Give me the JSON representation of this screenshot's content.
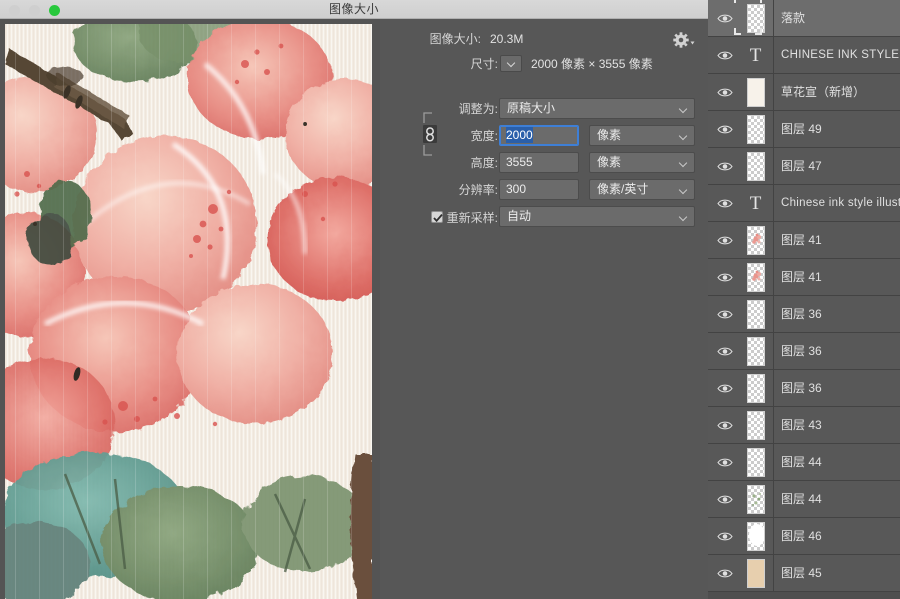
{
  "window": {
    "title": "图像大小",
    "controls": [
      {
        "name": "close",
        "color": "#cfcfcf"
      },
      {
        "name": "minimize",
        "color": "#cfcfcf"
      },
      {
        "name": "zoom",
        "color": "#28c83c"
      }
    ]
  },
  "dialog": {
    "image_size": {
      "label": "图像大小:",
      "value": "20.3M"
    },
    "gear_icon": "gear-icon",
    "dimensions": {
      "label": "尺寸:",
      "value": "2000 像素 × 3555 像素"
    },
    "fit_to": {
      "label": "调整为:",
      "value": "原稿大小"
    },
    "width": {
      "label": "宽度:",
      "value": "2000",
      "unit": "像素",
      "focused": true,
      "selected": true
    },
    "height": {
      "label": "高度:",
      "value": "3555",
      "unit": "像素"
    },
    "resolution": {
      "label": "分辨率:",
      "value": "300",
      "unit": "像素/英寸"
    },
    "resample": {
      "label": "重新采样:",
      "value": "自动",
      "checked": true
    },
    "link_icon": "chain-link-icon"
  },
  "layers_panel": {
    "rows": [
      {
        "name": "落款",
        "kind": "raster",
        "selected": true,
        "thumb": "transparent"
      },
      {
        "name": "CHINESE INK STYLE",
        "kind": "text",
        "selected": false,
        "latin": true
      },
      {
        "name": "草花宣（新增）",
        "kind": "raster",
        "selected": false,
        "thumb": "paper"
      },
      {
        "name": "图层 49",
        "kind": "raster",
        "selected": false,
        "thumb": "transparent"
      },
      {
        "name": "图层 47",
        "kind": "raster",
        "selected": false,
        "thumb": "transparent"
      },
      {
        "name": "Chinese ink style illustration",
        "kind": "text",
        "selected": false,
        "latin": true
      },
      {
        "name": "图层 41",
        "kind": "raster",
        "selected": false,
        "thumb": "pink-blossom"
      },
      {
        "name": "图层 41",
        "kind": "raster",
        "selected": false,
        "thumb": "pink-blossom"
      },
      {
        "name": "图层 36",
        "kind": "raster",
        "selected": false,
        "thumb": "transparent"
      },
      {
        "name": "图层 36",
        "kind": "raster",
        "selected": false,
        "thumb": "transparent"
      },
      {
        "name": "图层 36",
        "kind": "raster",
        "selected": false,
        "thumb": "transparent"
      },
      {
        "name": "图层 43",
        "kind": "raster",
        "selected": false,
        "thumb": "transparent"
      },
      {
        "name": "图层 44",
        "kind": "raster",
        "selected": false,
        "thumb": "transparent"
      },
      {
        "name": "图层 44",
        "kind": "raster",
        "selected": false,
        "thumb": "green-specks"
      },
      {
        "name": "图层 46",
        "kind": "raster",
        "selected": false,
        "thumb": "white-blob"
      },
      {
        "name": "图层 45",
        "kind": "raster",
        "selected": false,
        "thumb": "tan-solid"
      }
    ]
  },
  "preview": {
    "description": "watercolor peaches on textured paper",
    "colors": {
      "paper": "#f3ece2",
      "peach_light": "#f2b8ae",
      "peach_mid": "#e8897f",
      "peach_deep": "#d9625c",
      "leaf_green": "#6f8c63",
      "leaf_teal": "#5f9b92",
      "branch_brown": "#5a4a3a"
    }
  }
}
